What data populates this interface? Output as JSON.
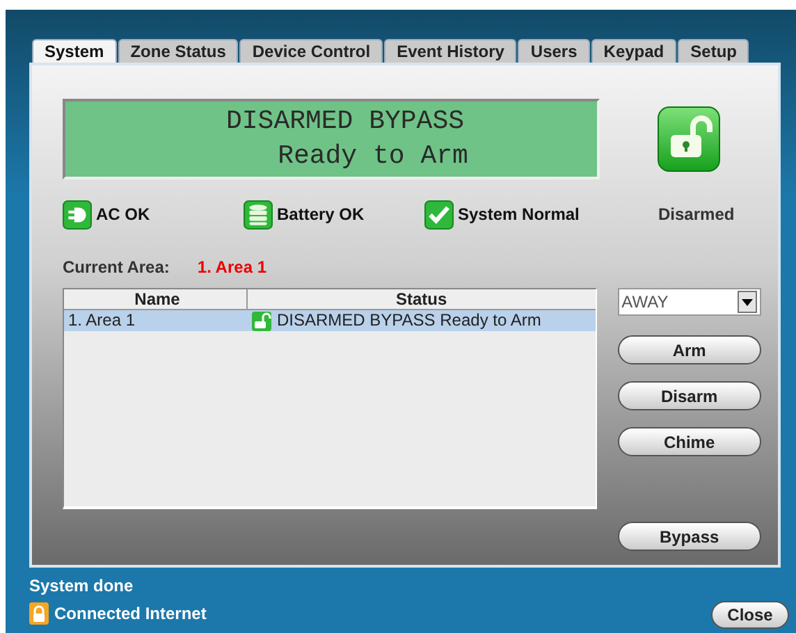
{
  "tabs": [
    {
      "label": "System",
      "selected": true
    },
    {
      "label": "Zone Status",
      "selected": false
    },
    {
      "label": "Device Control",
      "selected": false
    },
    {
      "label": "Event History",
      "selected": false
    },
    {
      "label": "Users",
      "selected": false
    },
    {
      "label": "Keypad",
      "selected": false
    },
    {
      "label": "Setup",
      "selected": false
    }
  ],
  "display": {
    "line_1": "DISARMED BYPASS",
    "line_2": "Ready to Arm"
  },
  "arm_state": {
    "label": "Disarmed",
    "armed": false
  },
  "indicators": [
    {
      "kind": "ac",
      "label": "AC OK"
    },
    {
      "kind": "battery",
      "label": "Battery OK"
    },
    {
      "kind": "system",
      "label": "System Normal"
    }
  ],
  "current_area": {
    "label": "Current Area:",
    "value": "1.  Area 1"
  },
  "table": {
    "columns": [
      "Name",
      "Status"
    ],
    "rows": [
      {
        "name": "1.  Area 1",
        "status": "DISARMED BYPASS Ready to Arm",
        "armed": false,
        "selected": true
      }
    ]
  },
  "mode_select": {
    "value": "AWAY"
  },
  "buttons": [
    "Arm",
    "Disarm",
    "Chime"
  ],
  "bypass_button": "Bypass",
  "status_message": "System done",
  "connection": "Connected Internet",
  "close_button": "Close"
}
